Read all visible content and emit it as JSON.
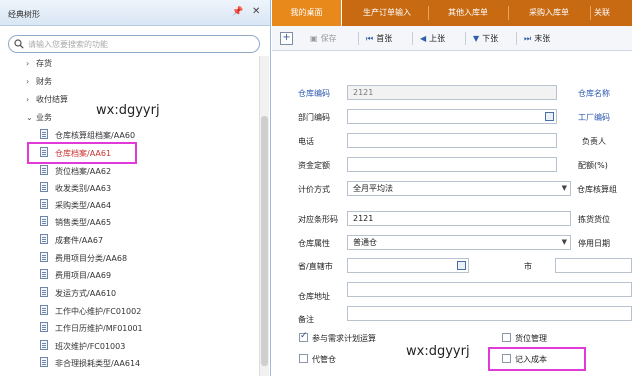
{
  "left_panel": {
    "title": "经典树形",
    "pin_icon": "pin-icon",
    "close_icon": "close-icon",
    "search_placeholder": "请输入您要搜索的功能",
    "groups": [
      "存货",
      "财务",
      "收付结算",
      "业务"
    ],
    "leaves": [
      "仓库核算组档案/AA60",
      "仓库档案/AA61",
      "货位档案/AA62",
      "收发类别/AA63",
      "采购类型/AA64",
      "销售类型/AA65",
      "成套件/AA67",
      "费用项目分类/AA68",
      "费用项目/AA69",
      "发运方式/AA610",
      "工作中心维护/FC01002",
      "工作日历维护/MF01001",
      "班次维护/FC01003",
      "非合理损耗类型/AA614"
    ],
    "selected": "仓库档案/AA61"
  },
  "watermarks": [
    "wx:dgyyrj",
    "wx:dgyyrj"
  ],
  "tabs": [
    "我的桌面",
    "生产订单输入",
    "其他入库单",
    "采购入库单",
    "关联"
  ],
  "toolbar": {
    "save": "保存",
    "first": "首张",
    "prev": "上张",
    "next": "下张",
    "last": "末张"
  },
  "form": {
    "warehouse_code_label": "仓库编码",
    "warehouse_code_value": "2121",
    "warehouse_name_label": "仓库名称",
    "dept_code_label": "部门编码",
    "factory_code_label": "工厂编码",
    "phone_label": "电话",
    "manager_label": "负责人",
    "capital_quota_label": "资金定额",
    "ratio_label": "配额(%)",
    "pricing_label": "计价方式",
    "pricing_value": "全月平均法",
    "accounting_group_label": "仓库核算组",
    "barcode_label": "对应条形码",
    "barcode_value": "2121",
    "pick_location_label": "拣货货位",
    "property_label": "仓库属性",
    "property_value": "普通仓",
    "disable_date_label": "停用日期",
    "province_label": "省/直辖市",
    "city_label": "市",
    "address_label": "仓库地址",
    "remark_label": "备注",
    "chk_mrp": "参与需求计划运算",
    "chk_location": "货位管理",
    "chk_proxy": "代管仓",
    "chk_cost": "记入成本"
  }
}
